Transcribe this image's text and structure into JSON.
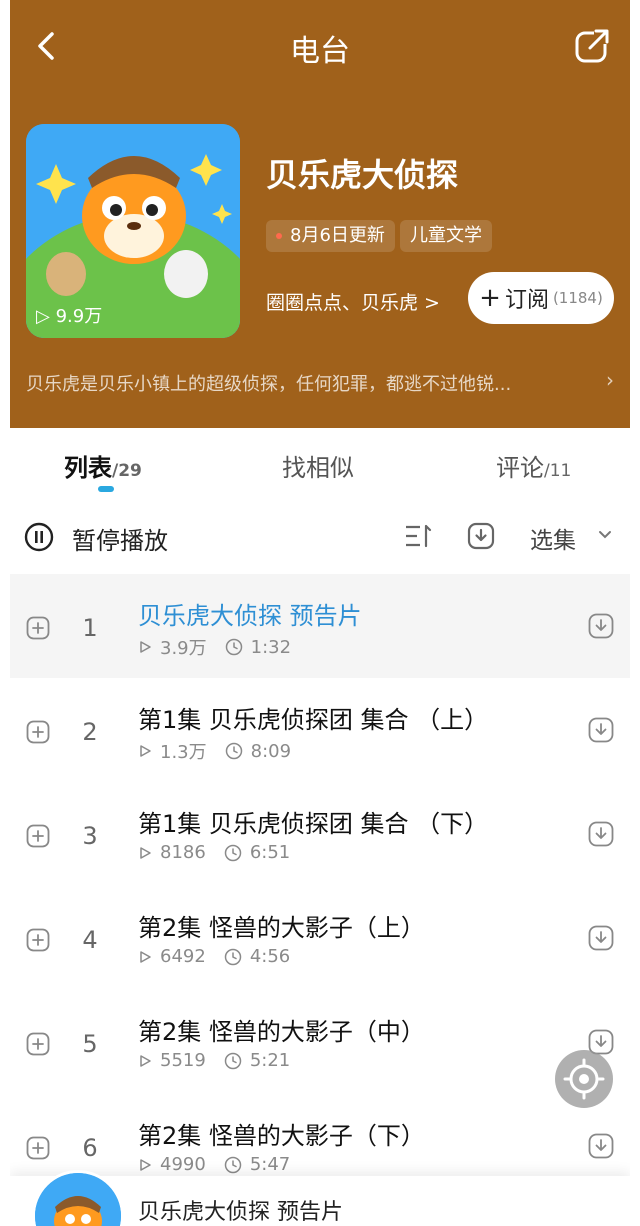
{
  "nav": {
    "title": "电台"
  },
  "album": {
    "title": "贝乐虎大侦探",
    "cover_text": "贝乐虎大侦探",
    "play_count": "9.9万",
    "tag_update": "8月6日更新",
    "tag_category": "儿童文学",
    "author": "圈圈点点、贝乐虎 >",
    "subscribe_label": "订阅",
    "subscribe_count": "(1184)",
    "description": "贝乐虎是贝乐小镇上的超级侦探，任何犯罪，都逃不过他锐...",
    "accent_color": "#a0611b"
  },
  "tabs": [
    {
      "label": "列表",
      "count": "/29"
    },
    {
      "label": "找相似",
      "count": ""
    },
    {
      "label": "评论",
      "count": "/11"
    }
  ],
  "toolbar": {
    "pause_label": "暂停播放",
    "select_label": "选集"
  },
  "episodes": [
    {
      "num": "1",
      "title": "贝乐虎大侦探 预告片",
      "plays": "3.9万",
      "duration": "1:32"
    },
    {
      "num": "2",
      "title": "第1集 贝乐虎侦探团  集合 （上）",
      "plays": "1.3万",
      "duration": "8:09"
    },
    {
      "num": "3",
      "title": "第1集 贝乐虎侦探团  集合 （下）",
      "plays": "8186",
      "duration": "6:51"
    },
    {
      "num": "4",
      "title": "第2集 怪兽的大影子（上）",
      "plays": "6492",
      "duration": "4:56"
    },
    {
      "num": "5",
      "title": "第2集 怪兽的大影子（中）",
      "plays": "5519",
      "duration": "5:21"
    },
    {
      "num": "6",
      "title": "第2集 怪兽的大影子（下）",
      "plays": "4990",
      "duration": "5:47"
    }
  ],
  "mini_player": {
    "title": "贝乐虎大侦探 预告片"
  }
}
